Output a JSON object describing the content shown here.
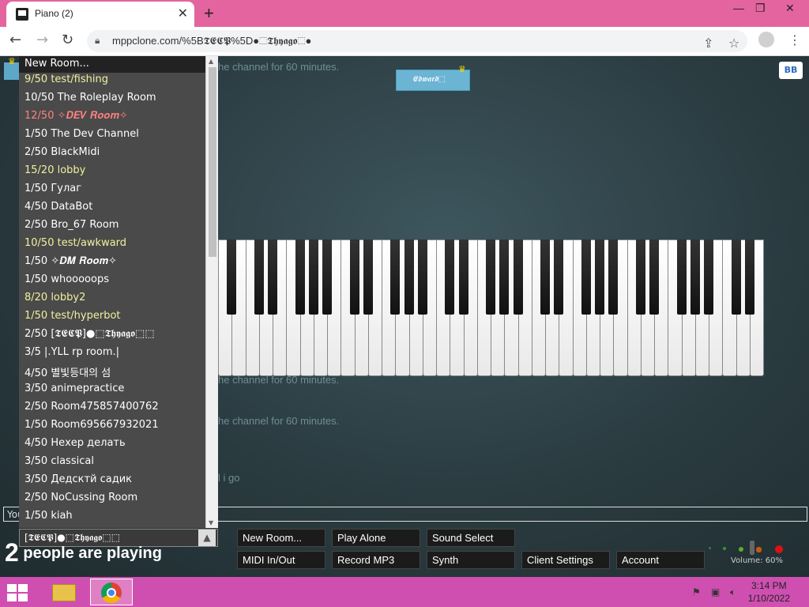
{
  "browser": {
    "tab_title": "Piano (2)",
    "tab_close": "✕",
    "new_tab": "+",
    "url": "mppclone.com/%5B𝕿𝕰𝕮𝕻%5D●⬚𝕿𝖍𝖞𝖆𝖌𝖔⬚●",
    "min": "—",
    "max": "❐",
    "close": "✕"
  },
  "chat": [
    "he channel for 60 minutes.",
    "he channel for 60 minutes.",
    "he channel for 60 minutes.",
    "l i go"
  ],
  "user_tag": "𝕰𝖉𝖜𝖆𝖗𝖉⬚",
  "bb_label": "BB",
  "room_list": {
    "header": "New Room...",
    "rooms": [
      {
        "label": "9/50 test/fishing",
        "color": "#f0f0a0"
      },
      {
        "label": "10/50 The Roleplay Room",
        "color": "#ffffff"
      },
      {
        "label": "12/50 ✧𝑫𝑬𝑽 𝑹𝒐𝒐𝒎✧",
        "color": "#ff8080"
      },
      {
        "label": "1/50 The Dev Channel",
        "color": "#ffffff"
      },
      {
        "label": "2/50 BlackMidi",
        "color": "#ffffff"
      },
      {
        "label": "15/20 lobby",
        "color": "#f0f0a0"
      },
      {
        "label": "1/50 Гулаг",
        "color": "#ffffff"
      },
      {
        "label": "4/50 DataBot",
        "color": "#ffffff"
      },
      {
        "label": "2/50 Bro_67 Room",
        "color": "#ffffff"
      },
      {
        "label": "10/50 test/awkward",
        "color": "#f0f0a0"
      },
      {
        "label": "1/50 ✧𝑫𝑴 𝑹𝒐𝒐𝒎✧",
        "color": "#ffffff"
      },
      {
        "label": "1/50 whooooops",
        "color": "#ffffff"
      },
      {
        "label": "8/20 lobby2",
        "color": "#f0f0a0"
      },
      {
        "label": "1/50 test/hyperbot",
        "color": "#f0f0a0"
      },
      {
        "label": "2/50 [𝕿𝕰𝕮𝕻]●⬚𝕿𝖍𝖞𝖆𝖌𝖔⬚⬚",
        "color": "#ffffff"
      },
      {
        "label": "3/5 |.YLL rp room.|",
        "color": "#ffffff"
      },
      {
        "label": "4/50 별빛등대의 섬",
        "color": "#ffffff"
      },
      {
        "label": "3/50 animepractice",
        "color": "#ffffff"
      },
      {
        "label": "2/50 Room475857400762",
        "color": "#ffffff"
      },
      {
        "label": "1/50 Room695667932021",
        "color": "#ffffff"
      },
      {
        "label": "4/50 Нехер делать",
        "color": "#ffffff"
      },
      {
        "label": "3/50 classical",
        "color": "#ffffff"
      },
      {
        "label": "3/50 Дедсктй садик",
        "color": "#ffffff"
      },
      {
        "label": "2/50 NoCussing Room",
        "color": "#ffffff"
      },
      {
        "label": "1/50 kiah",
        "color": "#ffffff"
      }
    ],
    "current": "[𝕿𝕰𝕮𝕻]●⬚𝕿𝖍𝖞𝖆𝖌𝖔⬚⬚"
  },
  "chat_input_placeholder": "You",
  "player_count": {
    "num": "2",
    "text": " people are playing"
  },
  "controls": {
    "new_room": "New Room...",
    "play_alone": "Play Alone",
    "sound_select": "Sound Select",
    "midi": "MIDI In/Out",
    "record": "Record MP3",
    "synth": "Synth",
    "client_settings": "Client Settings",
    "account": "Account"
  },
  "volume": "Volume: 60%",
  "taskbar": {
    "time": "3:14 PM",
    "date": "1/10/2022"
  }
}
